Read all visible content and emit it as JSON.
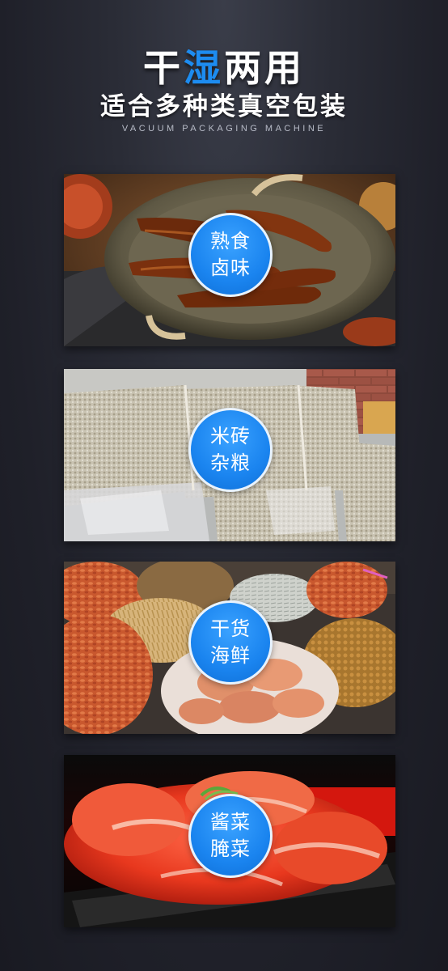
{
  "header": {
    "title_part1": "干",
    "title_highlight": "湿",
    "title_part2": "两用",
    "subtitle": "适合多种类真空包装",
    "english": "VACUUM PACKAGING MACHINE"
  },
  "colors": {
    "accent": "#1d8cf0",
    "background": "#1f2029",
    "badge": "#1a84ef"
  },
  "cards": [
    {
      "line1": "熟食",
      "line2": "卤味",
      "image": "braised-duck-wings-photo"
    },
    {
      "line1": "米砖",
      "line2": "杂粮",
      "image": "vacuum-rice-bricks-photo"
    },
    {
      "line1": "干货",
      "line2": "海鲜",
      "image": "dried-seafood-photo"
    },
    {
      "line1": "酱菜",
      "line2": "腌菜",
      "image": "kimchi-photo"
    }
  ]
}
